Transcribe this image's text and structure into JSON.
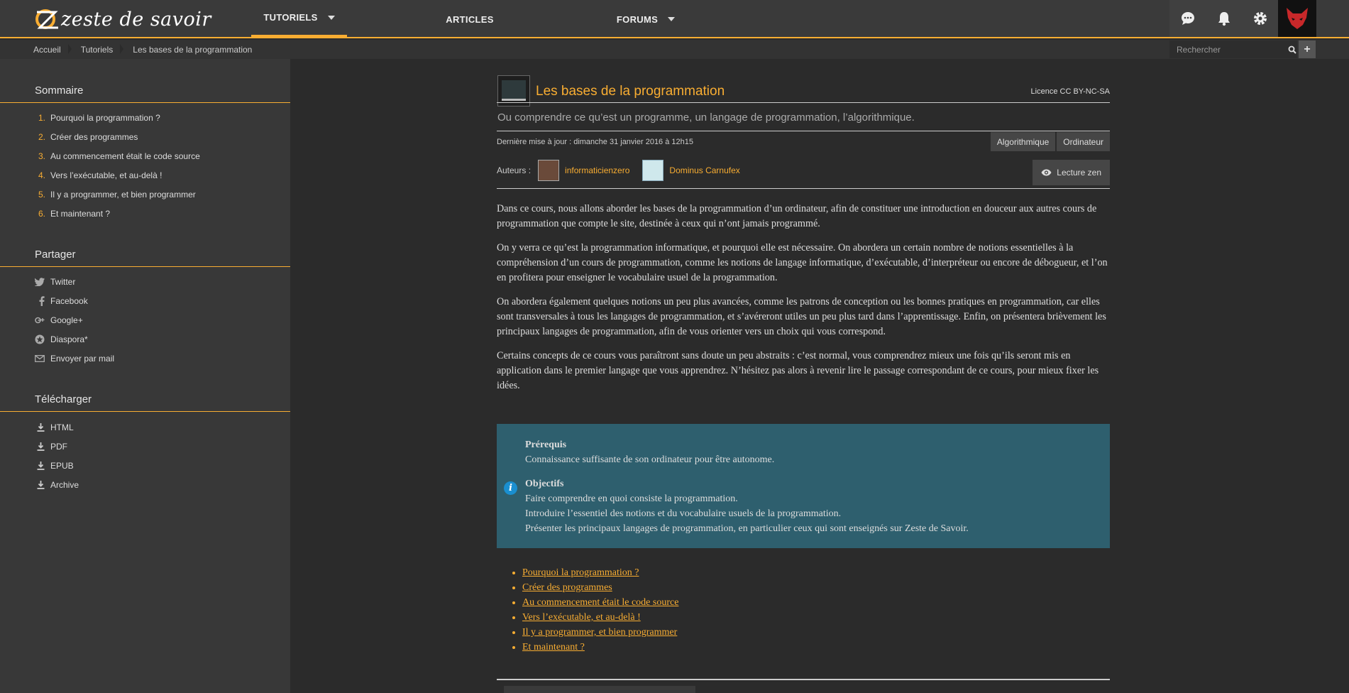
{
  "header": {
    "logo_text": "zeste de savoir",
    "nav": [
      {
        "label": "TUTORIELS",
        "has_dropdown": true,
        "active": true
      },
      {
        "label": "ARTICLES",
        "has_dropdown": false
      },
      {
        "label": "FORUMS",
        "has_dropdown": true
      }
    ],
    "icons": [
      "chat-icon",
      "bell-icon",
      "gear-icon",
      "avatar-fox"
    ]
  },
  "breadcrumb": [
    "Accueil",
    "Tutoriels",
    "Les bases de la programmation"
  ],
  "search": {
    "placeholder": "Rechercher"
  },
  "sidebar": {
    "sommaire_title": "Sommaire",
    "sommaire": [
      {
        "num": "1.",
        "label": "Pourquoi la programmation ?"
      },
      {
        "num": "2.",
        "label": "Créer des programmes"
      },
      {
        "num": "3.",
        "label": "Au commencement était le code source"
      },
      {
        "num": "4.",
        "label": "Vers l’exécutable, et au-delà !"
      },
      {
        "num": "5.",
        "label": "Il y a programmer, et bien programmer"
      },
      {
        "num": "6.",
        "label": "Et maintenant ?"
      }
    ],
    "partager_title": "Partager",
    "partager": [
      {
        "icon": "twitter-icon",
        "label": "Twitter"
      },
      {
        "icon": "facebook-icon",
        "label": "Facebook"
      },
      {
        "icon": "google-plus-icon",
        "label": "Google+"
      },
      {
        "icon": "diaspora-icon",
        "label": "Diaspora*"
      },
      {
        "icon": "mail-icon",
        "label": "Envoyer par mail"
      }
    ],
    "telecharger_title": "Télécharger",
    "telecharger": [
      {
        "icon": "download-icon",
        "label": "HTML"
      },
      {
        "icon": "download-icon",
        "label": "PDF"
      },
      {
        "icon": "download-icon",
        "label": "EPUB"
      },
      {
        "icon": "download-icon",
        "label": "Archive"
      }
    ]
  },
  "article": {
    "title": "Les bases de la programmation",
    "licence": "Licence CC BY-NC-SA",
    "subtitle": "Ou comprendre ce qu’est un programme, un langage de programmation, l’algorithmique.",
    "last_update": "Dernière mise à jour : dimanche 31 janvier 2016 à 12h15",
    "tags": [
      "Algorithmique",
      "Ordinateur"
    ],
    "authors_label": "Auteurs :",
    "authors": [
      "informaticienzero",
      "Dominus Carnufex"
    ],
    "zen_label": "Lecture zen",
    "paragraphs": [
      "Dans ce cours, nous allons aborder les bases de la programmation d’un ordinateur, afin de constituer une introduction en douceur aux autres cours de programmation que compte le site, destinée à ceux qui n’ont jamais programmé.",
      "On y verra ce qu’est la programmation informatique, et pourquoi elle est nécessaire. On abordera un certain nombre de notions essentielles à la compréhension d’un cours de programmation, comme les notions de langage informatique, d’exécutable, d’interpréteur ou encore de débogueur, et l’on en profitera pour enseigner le vocabulaire usuel de la programmation.",
      "On abordera également quelques notions un peu plus avancées, comme les patrons de conception ou les bonnes pratiques en programmation, car elles sont transversales à tous les langages de programmation, et s’avéreront utiles un peu plus tard dans l’apprentissage. Enfin, on présentera brièvement les principaux langages de programmation, afin de vous orienter vers un choix qui vous correspond.",
      "Certains concepts de ce cours vous paraîtront sans doute un peu abstraits : c’est normal, vous comprendrez mieux une fois qu’ils seront mis en application dans le premier langage que vous apprendrez. N’hésitez pas alors à revenir lire le passage correspondant de ce cours, pour mieux fixer les idées."
    ],
    "info": {
      "prereq_title": "Prérequis",
      "prereq": "Connaissance suffisante de son ordinateur pour être autonome.",
      "obj_title": "Objectifs",
      "objectives": [
        "Faire comprendre en quoi consiste la programmation.",
        "Introduire l’essentiel des notions et du vocabulaire usuels de la programmation.",
        "Présenter les principaux langages de programmation, en particulier ceux qui sont enseignés sur Zeste de Savoir."
      ]
    },
    "toc": [
      "Pourquoi la programmation ?",
      "Créer des programmes",
      "Au commencement était le code source",
      "Vers l’exécutable, et au-delà !",
      "Il y a programmer, et bien programmer",
      "Et maintenant ?"
    ]
  },
  "colors": {
    "accent": "#f8ad32",
    "bg": "#2b2b2b",
    "sidebar": "#383838",
    "info": "#2e5f6e"
  }
}
